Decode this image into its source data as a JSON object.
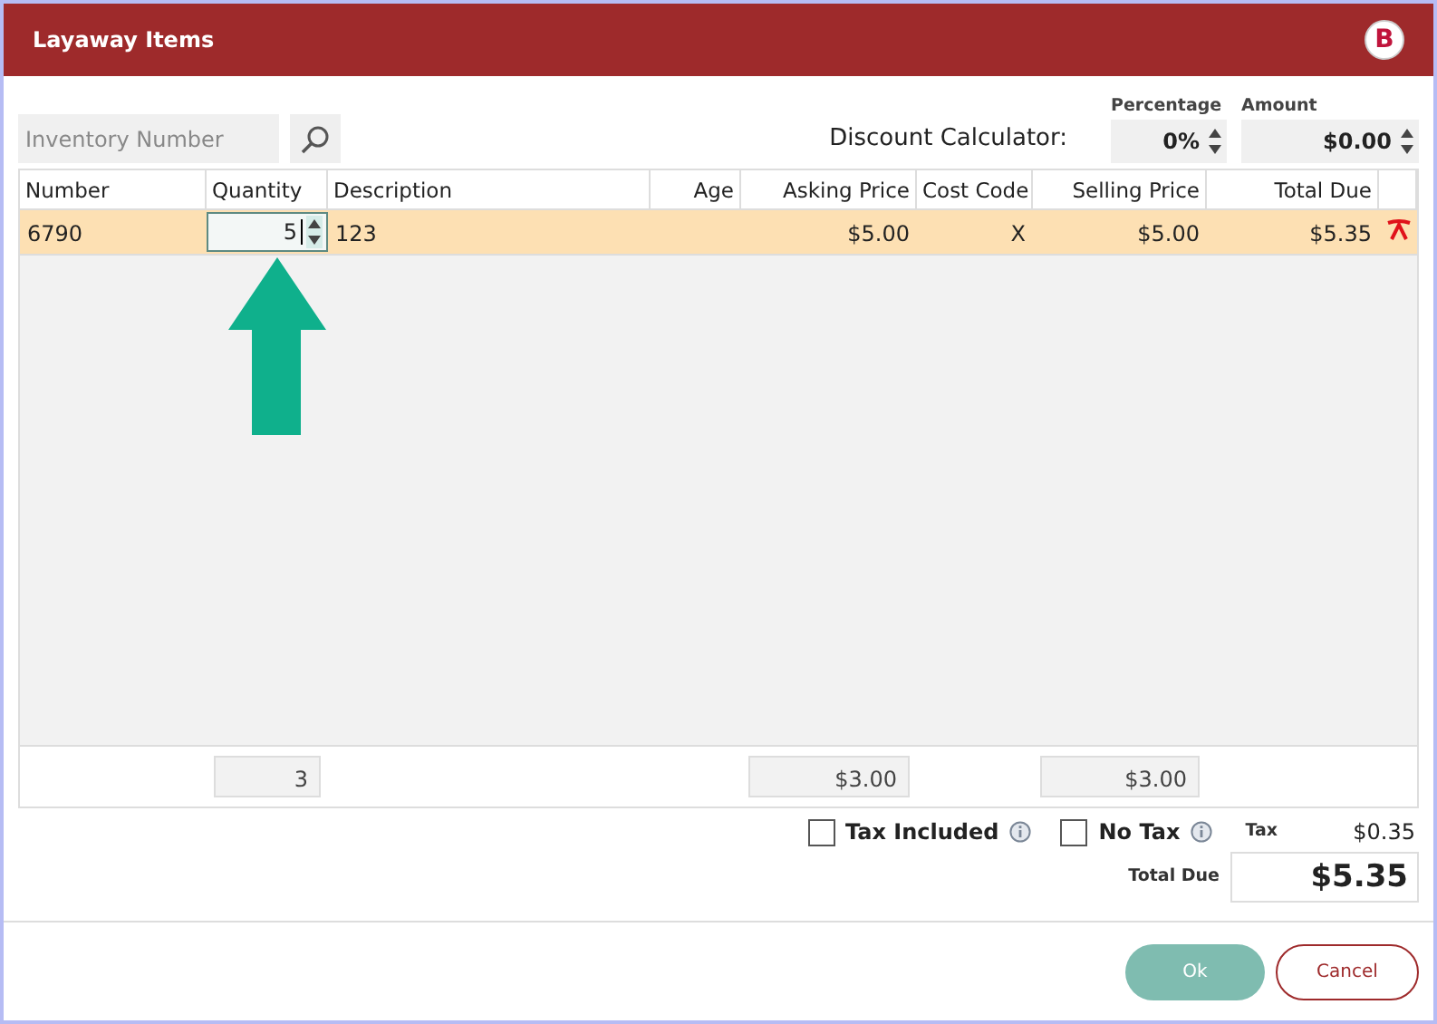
{
  "window": {
    "title": "Layaway Items",
    "logo": "B"
  },
  "toolbar": {
    "search": {
      "placeholder": "Inventory Number"
    },
    "discount_label": "Discount Calculator:",
    "percentage": {
      "label": "Percentage",
      "value": "0%"
    },
    "amount": {
      "label": "Amount",
      "value": "$0.00"
    }
  },
  "table": {
    "columns": [
      "Number",
      "Quantity",
      "Description",
      "Age",
      "Asking Price",
      "Cost Code",
      "Selling Price",
      "Total Due"
    ],
    "rows": [
      {
        "selected": true,
        "number": "6790",
        "quantity": "5",
        "description": "123",
        "age": "",
        "asking_price": "$5.00",
        "cost_code": "X",
        "selling_price": "$5.00",
        "total_due": "$5.35"
      }
    ],
    "totals": {
      "quantity": "3",
      "asking_price": "$3.00",
      "selling_price": "$3.00"
    }
  },
  "tax": {
    "tax_included": {
      "label": "Tax Included",
      "checked": false
    },
    "no_tax": {
      "label": "No Tax",
      "checked": false
    },
    "tax_label": "Tax",
    "tax_value": "$0.35",
    "total_label": "Total Due",
    "total_value": "$5.35"
  },
  "buttons": [
    {
      "kind": "primary",
      "label": "Ok"
    },
    {
      "kind": "secondary",
      "label": "Cancel"
    }
  ]
}
